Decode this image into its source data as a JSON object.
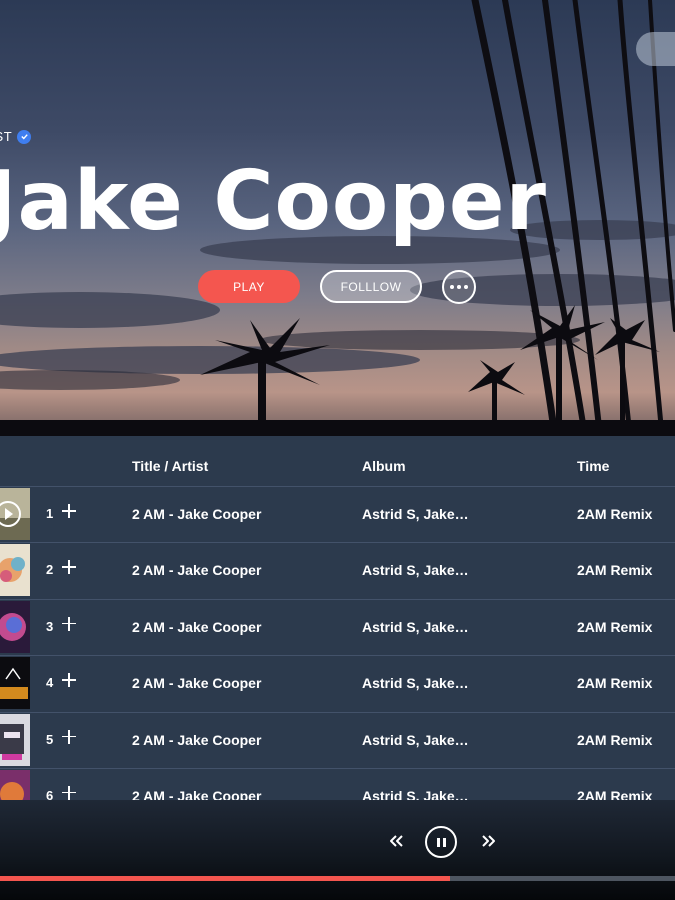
{
  "hero": {
    "artist_label": "TIST",
    "artist_name": "Jake Cooper",
    "play_label": "PLAY",
    "follow_label": "FOLLLOW",
    "more_icon": "more-dots-icon",
    "verified_icon": "verified-check-icon"
  },
  "table": {
    "headers": {
      "title": "Title / Artist",
      "album": "Album",
      "time": "Time"
    },
    "rows": [
      {
        "num": "1",
        "title": "2 AM - Jake Cooper",
        "album": "Astrid S, Jake…",
        "time": "2AM Remix"
      },
      {
        "num": "2",
        "title": "2 AM - Jake Cooper",
        "album": "Astrid S, Jake…",
        "time": "2AM Remix"
      },
      {
        "num": "3",
        "title": "2 AM - Jake Cooper",
        "album": "Astrid S, Jake…",
        "time": "2AM Remix"
      },
      {
        "num": "4",
        "title": "2 AM - Jake Cooper",
        "album": "Astrid S, Jake…",
        "time": "2AM Remix"
      },
      {
        "num": "5",
        "title": "2 AM - Jake Cooper",
        "album": "Astrid S, Jake…",
        "time": "2AM Remix"
      },
      {
        "num": "6",
        "title": "2 AM - Jake Cooper",
        "album": "Astrid S, Jake…",
        "time": "2AM Remix"
      }
    ]
  },
  "player": {
    "progress_fraction": 0.667
  },
  "colors": {
    "accent": "#f4564f",
    "list_bg": "#2c3a4d",
    "verified": "#3f7ef0"
  }
}
